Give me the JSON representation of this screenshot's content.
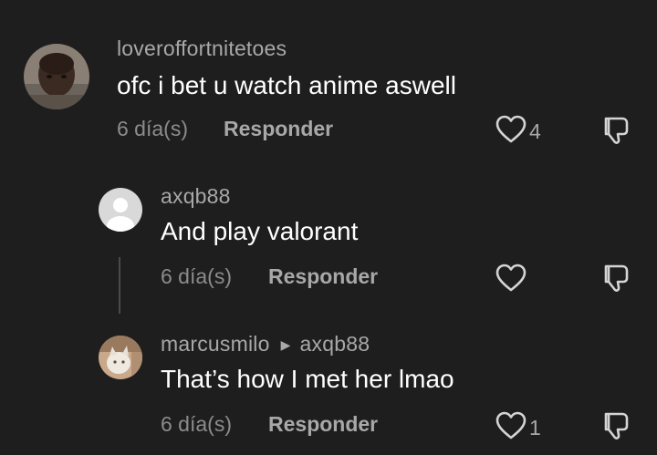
{
  "comments": [
    {
      "username": "loveroffortnitetoes",
      "text": "ofc i bet u watch anime aswell",
      "time": "6 día(s)",
      "reply_label": "Responder",
      "likes": "4"
    },
    {
      "username": "axqb88",
      "text": "And play valorant",
      "time": "6 día(s)",
      "reply_label": "Responder",
      "likes": ""
    },
    {
      "username": "marcusmilo",
      "reply_to": "axqb88",
      "text": "That’s how I met her lmao",
      "time": "6 día(s)",
      "reply_label": "Responder",
      "likes": "1"
    }
  ],
  "icons": {
    "like": "heart-icon",
    "dislike": "thumbs-down-icon",
    "reply_arrow": "triangle-right-icon"
  },
  "colors": {
    "background": "#1e1e1e",
    "username": "#a8a8a8",
    "text": "#ffffff",
    "meta": "#8c8c8c"
  }
}
